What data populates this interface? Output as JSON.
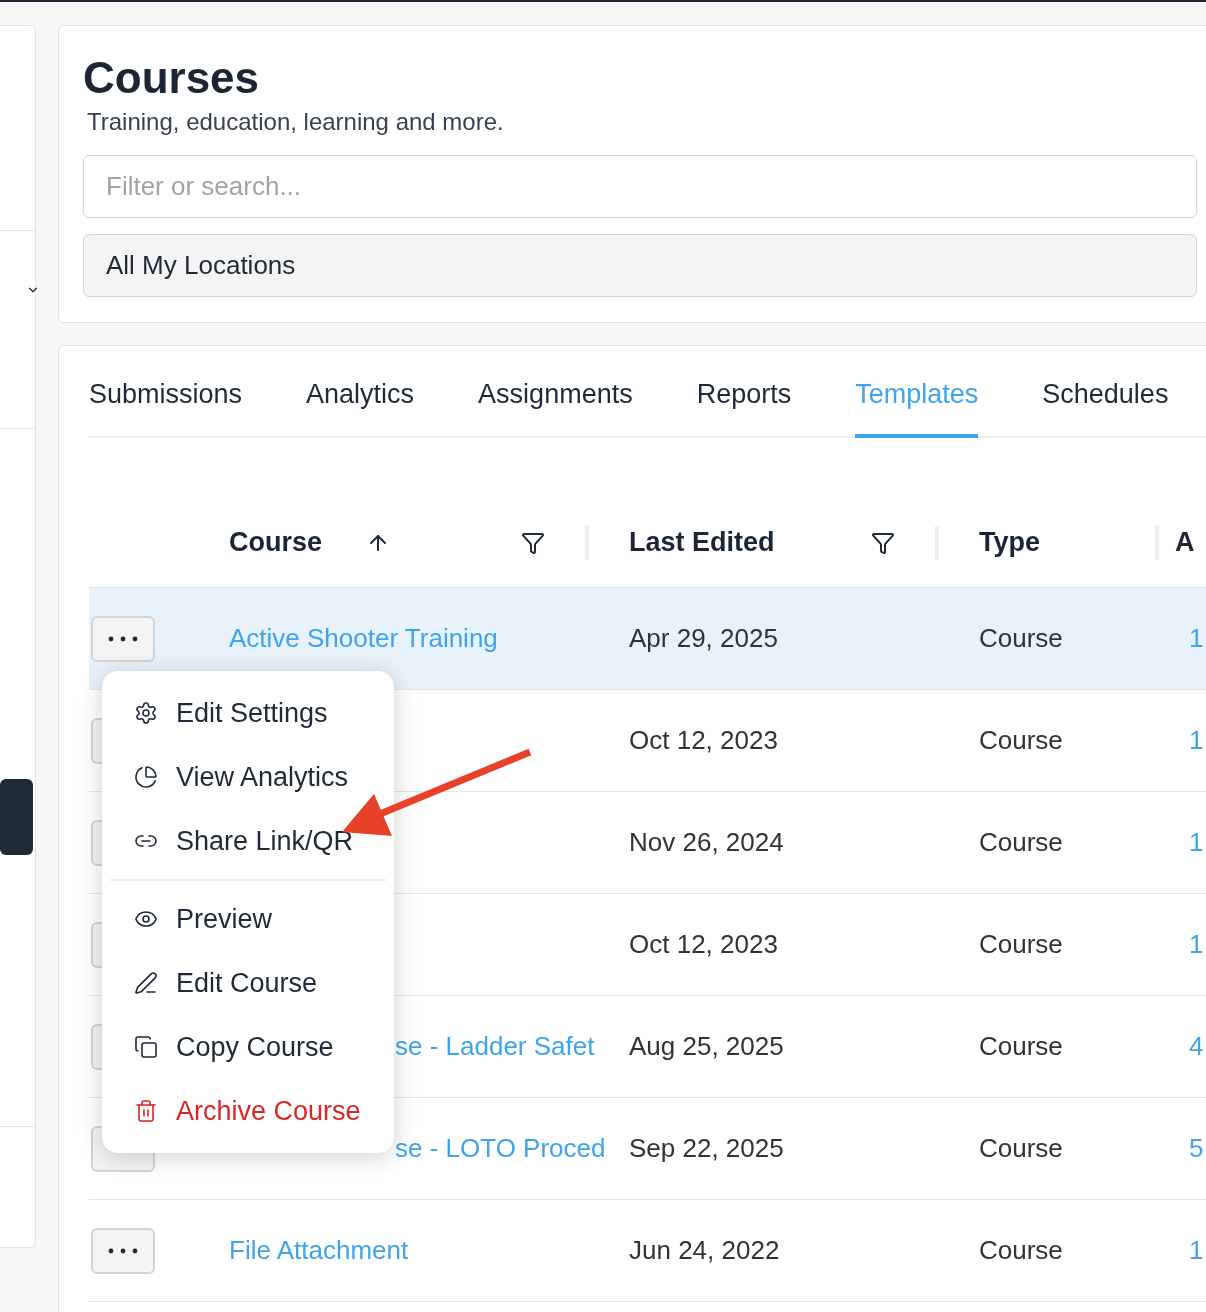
{
  "page": {
    "title": "Courses",
    "subtitle": "Training, education, learning and more.",
    "search": {
      "placeholder": "Filter or search..."
    },
    "location_select": {
      "value": "All My Locations"
    }
  },
  "tabs": [
    {
      "label": "Submissions",
      "selected": false
    },
    {
      "label": "Analytics",
      "selected": false
    },
    {
      "label": "Assignments",
      "selected": false
    },
    {
      "label": "Reports",
      "selected": false
    },
    {
      "label": "Templates",
      "selected": true
    },
    {
      "label": "Schedules",
      "selected": false
    }
  ],
  "table": {
    "columns": [
      {
        "label": "Course",
        "sorted_ascending": true,
        "filter": true
      },
      {
        "label": "Last Edited",
        "filter": true
      },
      {
        "label": "Type"
      },
      {
        "label": "A"
      }
    ],
    "rows": [
      {
        "selected": true,
        "menu_open": true,
        "course": "Active Shooter Training",
        "last_edited": "Apr 29, 2025",
        "type": "Course",
        "column_4": "1"
      },
      {
        "selected": false,
        "last_edited": "Oct 12, 2023",
        "type": "Course",
        "column_4": "1"
      },
      {
        "selected": false,
        "last_edited": "Nov 26, 2024",
        "type": "Course",
        "column_4": "1"
      },
      {
        "selected": false,
        "last_edited": "Oct 12, 2023",
        "type": "Course",
        "column_4": "1"
      },
      {
        "selected": false,
        "course": "se - Ladder Safet",
        "covered_start": true,
        "last_edited": "Aug 25, 2025",
        "type": "Course",
        "column_4": "4"
      },
      {
        "selected": false,
        "course": "se - LOTO Proced",
        "covered_start": true,
        "last_edited": "Sep 22, 2025",
        "type": "Course",
        "column_4": "5"
      },
      {
        "selected": false,
        "course": "File Attachment",
        "last_edited": "Jun 24, 2022",
        "type": "Course",
        "column_4": "1"
      }
    ]
  },
  "row_menu": {
    "groups": [
      [
        {
          "label": "Edit Settings",
          "kind": "settings"
        },
        {
          "label": "View Analytics",
          "kind": "analytics"
        },
        {
          "label": "Share Link/QR",
          "kind": "share"
        }
      ],
      [
        {
          "label": "Preview",
          "kind": "preview"
        },
        {
          "label": "Edit Course",
          "kind": "edit"
        },
        {
          "label": "Copy Course",
          "kind": "copy"
        },
        {
          "label": "Archive Course",
          "kind": "archive"
        }
      ]
    ]
  }
}
